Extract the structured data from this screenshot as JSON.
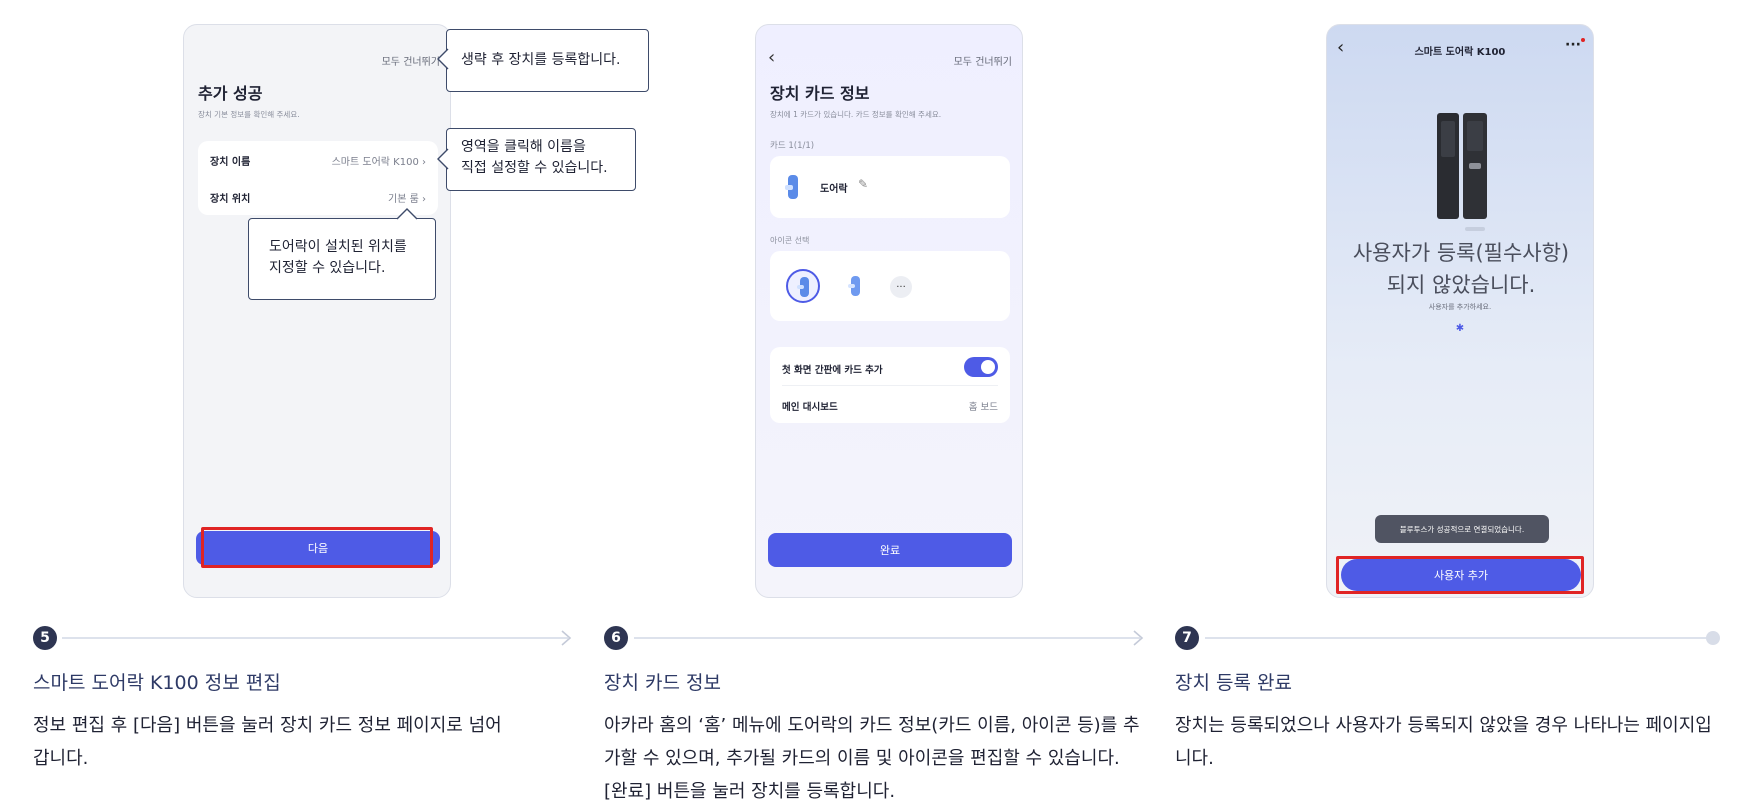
{
  "steps": [
    {
      "num": "5",
      "title": "스마트 도어락 K100 정보 편집",
      "desc": "정보 편집 후 [다음] 버튼을 눌러 장치 카드 정보 페이지로 넘어갑니다."
    },
    {
      "num": "6",
      "title": "장치 카드 정보",
      "desc": "아카라 홈의 ‘홈’ 메뉴에 도어락의 카드 정보(카드 이름, 아이콘 등)를 추가할 수 있으며, 추가될 카드의 이름 및 아이콘을 편집할 수 있습니다. [완료] 버튼을 눌러 장치를 등록합니다."
    },
    {
      "num": "7",
      "title": "장치 등록 완료",
      "desc": "장치는 등록되었으나 사용자가 등록되지 않았을 경우 나타나는 페이지입니다."
    }
  ],
  "screen1": {
    "skip": "모두 건너뛰기",
    "title": "추가 성공",
    "subtitle": "장치 기본 정보를 확인해 주세요.",
    "name_label": "장치 이름",
    "name_value": "스마트 도어락 K100",
    "location_label": "장치 위치",
    "location_value": "기본 룸",
    "next_button": "다음",
    "callouts": {
      "skip": "생략 후 장치를 등록합니다.",
      "name": "영역을 클릭해 이름을\n직접 설정할 수 있습니다.",
      "location": "도어락이 설치된 위치를\n지정할 수 있습니다."
    }
  },
  "screen2": {
    "skip": "모두 건너뛰기",
    "title": "장치 카드 정보",
    "subtitle": "장치에 1 카드가 있습니다. 카드 정보를 확인해 주세요.",
    "card_count": "카드 1(1/1)",
    "card_name": "도어락",
    "icon_section": "아이콘 선택",
    "more_glyph": "···",
    "add_home_label": "첫 화면 간판에 카드 추가",
    "add_home_on": true,
    "dashboard_label": "메인 대시보드",
    "dashboard_value": "홈 보드",
    "done_button": "완료"
  },
  "screen3": {
    "title": "스마트 도어락 K100",
    "more_glyph": "···",
    "heading": "사용자가 등록(필수사항)되지 않았습니다.",
    "subtext": "사용자를 추가하세요.",
    "toast": "블루투스가 성공적으로 연결되었습니다.",
    "add_user_button": "사용자 추가"
  },
  "colors": {
    "accent": "#4e5be6",
    "highlight": "#e02424",
    "step_badge": "#2e3552"
  }
}
